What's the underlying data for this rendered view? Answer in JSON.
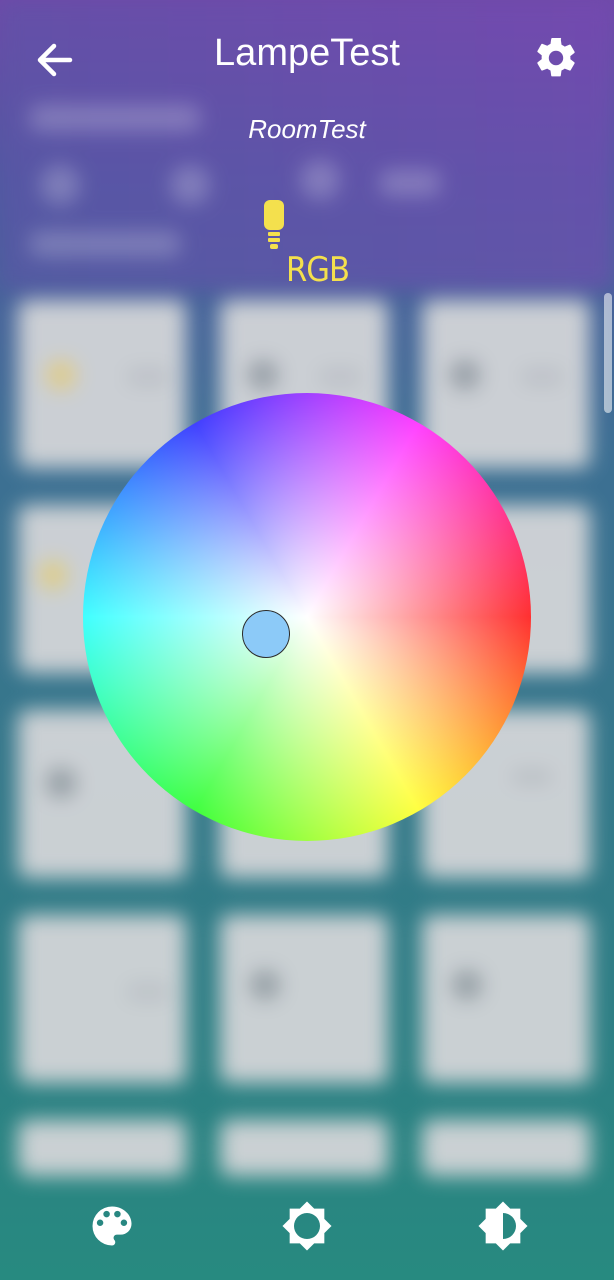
{
  "header": {
    "title": "LampeTest",
    "room": "RoomTest",
    "back_icon": "arrow-left-icon",
    "settings_icon": "gear-icon"
  },
  "lamp": {
    "icon": "lightbulb-icon",
    "mode": "RGB",
    "mode_color": "#f4e04d"
  },
  "color_wheel": {
    "selected_color": "#8ccaf8"
  },
  "bottom_nav": {
    "items": [
      {
        "icon": "palette-icon"
      },
      {
        "icon": "brightness-icon"
      },
      {
        "icon": "contrast-icon"
      }
    ]
  }
}
